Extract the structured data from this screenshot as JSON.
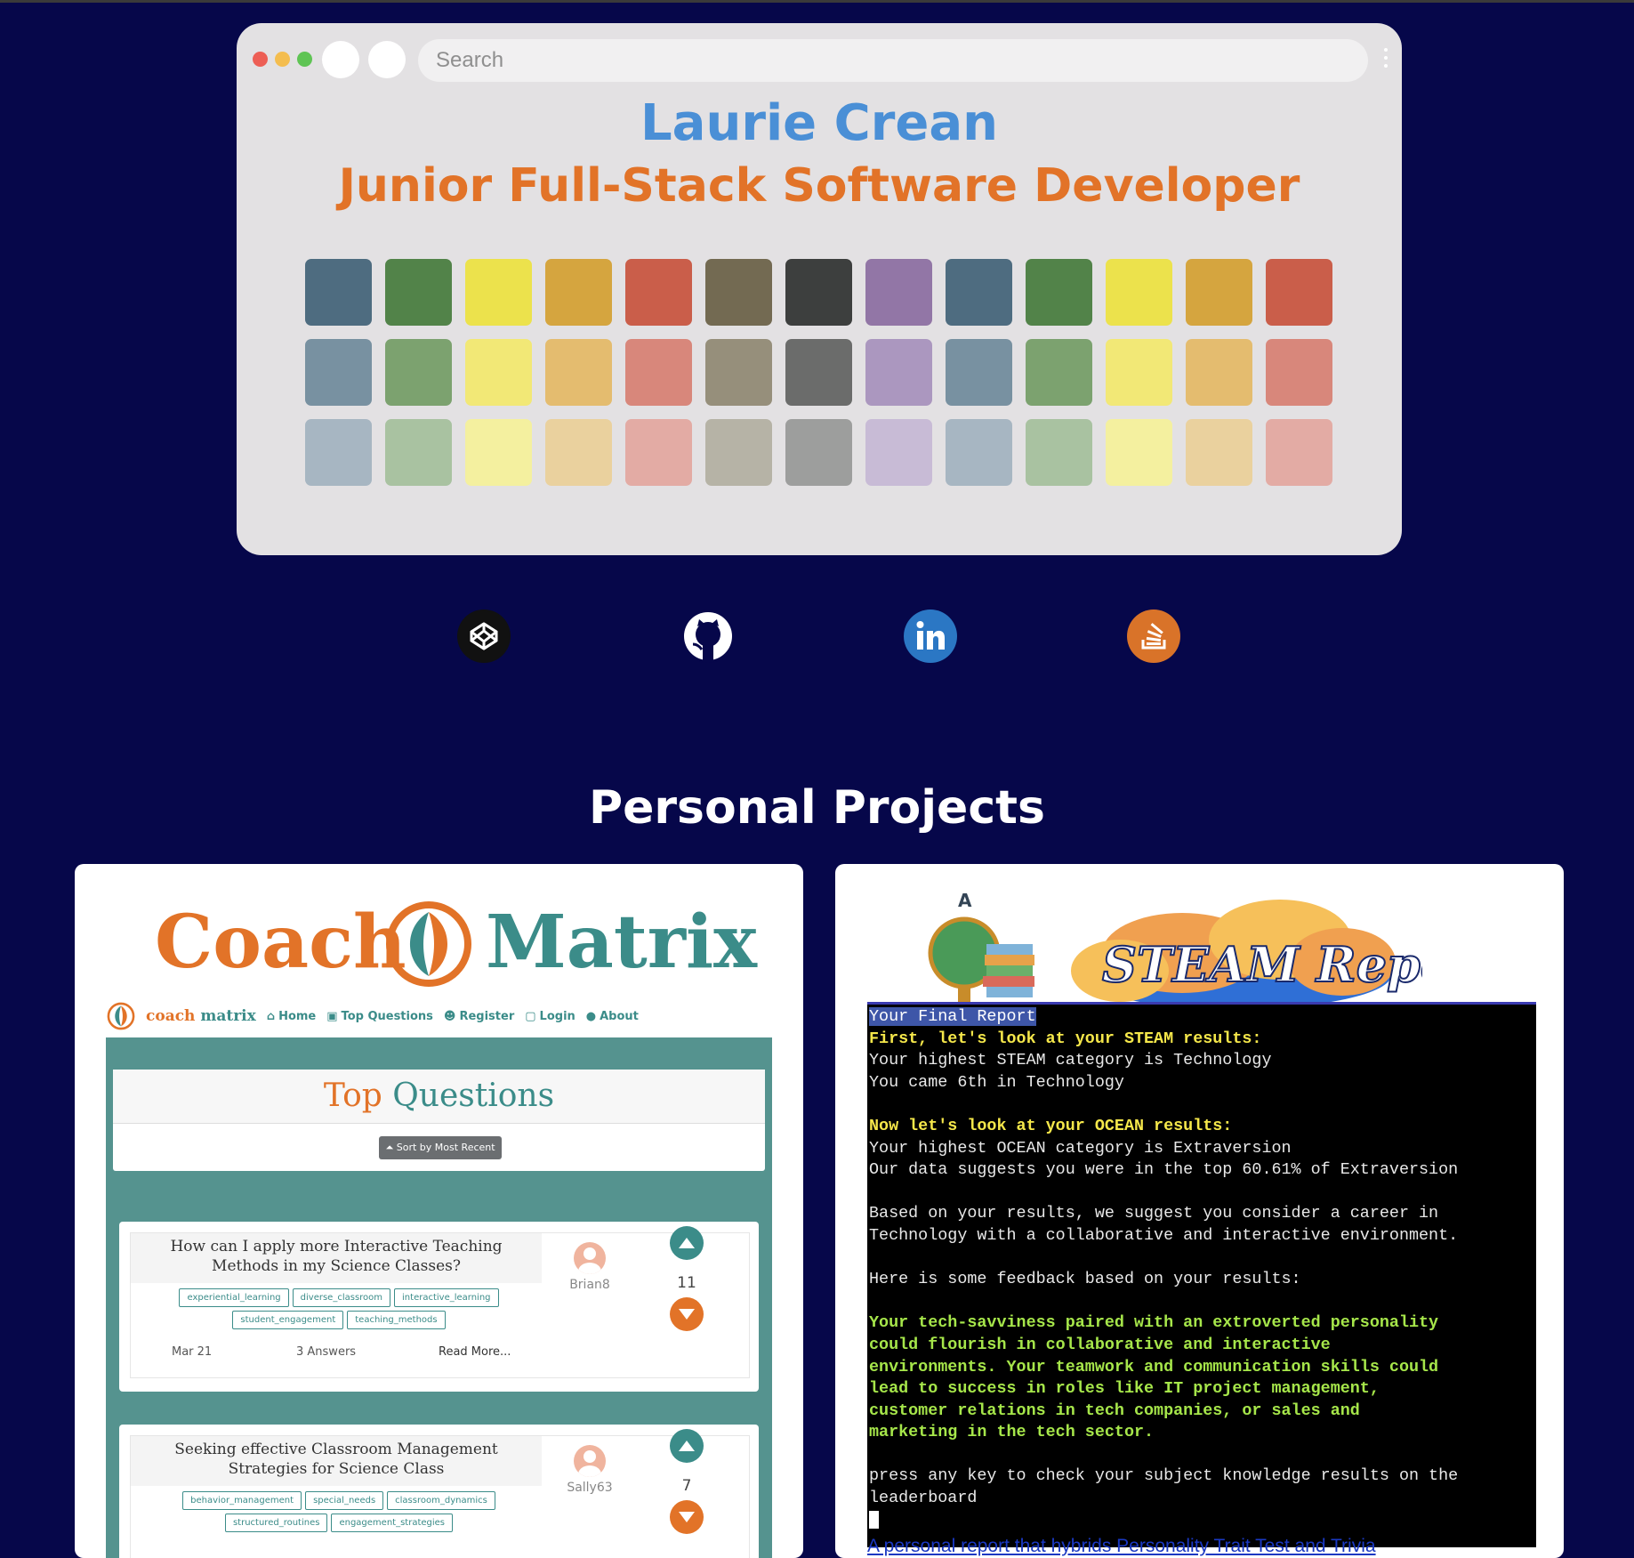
{
  "search": {
    "placeholder": "Search"
  },
  "header": {
    "name": "Laurie Crean",
    "role": "Junior Full-Stack Software Developer"
  },
  "window_dots": [
    "#ed5e55",
    "#f4bd4f",
    "#5fc454"
  ],
  "palette_colors": [
    "#4e6c80",
    "#528349",
    "#ece24c",
    "#d5a53f",
    "#ca5e4a",
    "#736a52",
    "#3d3f3e",
    "#9276a6",
    "#4e6c80",
    "#528349",
    "#ece24c",
    "#d5a53f",
    "#ca5e4a",
    "#7891a1",
    "#7ca26f",
    "#f2e876",
    "#e4bc6f",
    "#d8877b",
    "#968f7b",
    "#6b6c6b",
    "#ab97bf",
    "#7891a1",
    "#7ca26f",
    "#f2e876",
    "#e4bc6f",
    "#d8877b",
    "#a7b6c2",
    "#a9c2a1",
    "#f4f09f",
    "#ead19e",
    "#e3aba4",
    "#b6b3a6",
    "#9d9e9d",
    "#c8bbd6",
    "#a7b6c2",
    "#a9c2a1",
    "#f4f09f",
    "#ead19e",
    "#e3aba4"
  ],
  "social": [
    {
      "name": "codepen-icon",
      "bg": "#111111"
    },
    {
      "name": "github-icon",
      "bg": "#06074a"
    },
    {
      "name": "linkedin-icon",
      "bg": "#2b77c4"
    },
    {
      "name": "stackoverflow-icon",
      "bg": "#d97329"
    }
  ],
  "section_title": "Personal Projects",
  "coach_matrix": {
    "logo_word1": "Coach",
    "logo_word2": "Matrix",
    "nav": {
      "brand1": "coach",
      "brand2": "matrix",
      "items": [
        "Home",
        "Top Questions",
        "Register",
        "Login",
        "About"
      ]
    },
    "heading_a": "Top",
    "heading_b": "Questions",
    "sort_label": "Sort by Most Recent",
    "questions": [
      {
        "title_line1": "How can I apply more Interactive Teaching",
        "title_line2": "Methods in my Science Classes?",
        "tags": [
          "experiential_learning",
          "diverse_classroom",
          "interactive_learning",
          "student_engagement",
          "teaching_methods"
        ],
        "date": "Mar 21",
        "answers": "3 Answers",
        "read_more": "Read More...",
        "user": "Brian8",
        "votes": "11"
      },
      {
        "title_line1": "Seeking effective Classroom Management",
        "title_line2": "Strategies for Science Class",
        "tags": [
          "behavior_management",
          "special_needs",
          "classroom_dynamics",
          "structured_routines",
          "engagement_strategies"
        ],
        "user": "Sally63",
        "votes": "7"
      }
    ]
  },
  "steam": {
    "banner_title": "STEAM Report",
    "terminal": {
      "l01": "Your Final Report",
      "l02": "First, let's look at your STEAM results:",
      "l03": "Your highest STEAM category is Technology",
      "l04": "You came 6th in Technology",
      "l05": "Now let's look at your OCEAN results:",
      "l06": "Your highest OCEAN category is Extraversion",
      "l07": "Our data suggests you were in the top 60.61% of Extraversion",
      "l08": "Based on your results, we suggest you consider a career in",
      "l09": "Technology with a collaborative and interactive environment.",
      "l10": "Here is some feedback based on your results:",
      "l11": "Your tech-savviness paired with an extroverted personality",
      "l12": "could flourish in collaborative and interactive",
      "l13": "environments. Your teamwork and communication skills could",
      "l14": "lead to success in roles like IT project management,",
      "l15": "customer relations in tech companies, or sales and",
      "l16": "marketing in the tech sector.",
      "l17": "press any key to check your subject knowledge results on the",
      "l18": "leaderboard"
    },
    "caption": "A personal report that hybrids Personality Trait Test and Trivia"
  }
}
